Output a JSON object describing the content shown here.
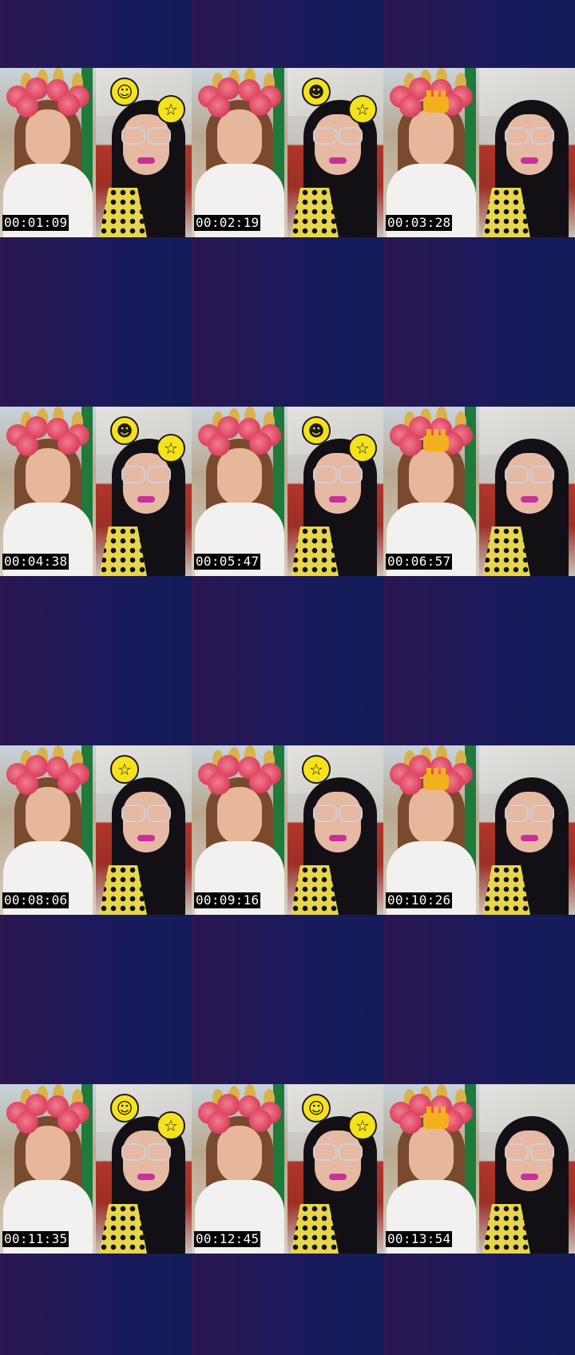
{
  "contact_sheet": {
    "thumbnails": [
      {
        "timestamp": "00:01:09",
        "effect": "flowers",
        "emoji": [
          "slightly-smiling-face-icon",
          "laughing-face-icon"
        ]
      },
      {
        "timestamp": "00:02:19",
        "effect": "flowers",
        "emoji": [
          "winking-face-icon",
          "laughing-face-icon"
        ]
      },
      {
        "timestamp": "00:03:28",
        "effect": "crown",
        "emoji": []
      },
      {
        "timestamp": "00:04:38",
        "effect": "flowers",
        "emoji": [
          "winking-face-icon",
          "laughing-face-icon"
        ]
      },
      {
        "timestamp": "00:05:47",
        "effect": "flowers",
        "emoji": [
          "winking-face-icon",
          "laughing-face-icon"
        ]
      },
      {
        "timestamp": "00:06:57",
        "effect": "crown",
        "emoji": []
      },
      {
        "timestamp": "00:08:06",
        "effect": "flowers",
        "emoji": [
          "laughing-face-icon"
        ]
      },
      {
        "timestamp": "00:09:16",
        "effect": "flowers",
        "emoji": [
          "laughing-face-icon"
        ]
      },
      {
        "timestamp": "00:10:26",
        "effect": "crown",
        "emoji": []
      },
      {
        "timestamp": "00:11:35",
        "effect": "flowers",
        "emoji": [
          "slightly-smiling-face-icon",
          "laughing-face-icon"
        ]
      },
      {
        "timestamp": "00:12:45",
        "effect": "flowers",
        "emoji": [
          "slightly-smiling-face-icon",
          "laughing-face-icon"
        ]
      },
      {
        "timestamp": "00:13:54",
        "effect": "crown",
        "emoji": []
      }
    ]
  },
  "colors": {
    "background_start": "#2a1650",
    "background_end": "#111c58",
    "timestamp_bg": "#000000",
    "timestamp_text": "#ffffff",
    "emoji_yellow": "#f6e21c"
  }
}
